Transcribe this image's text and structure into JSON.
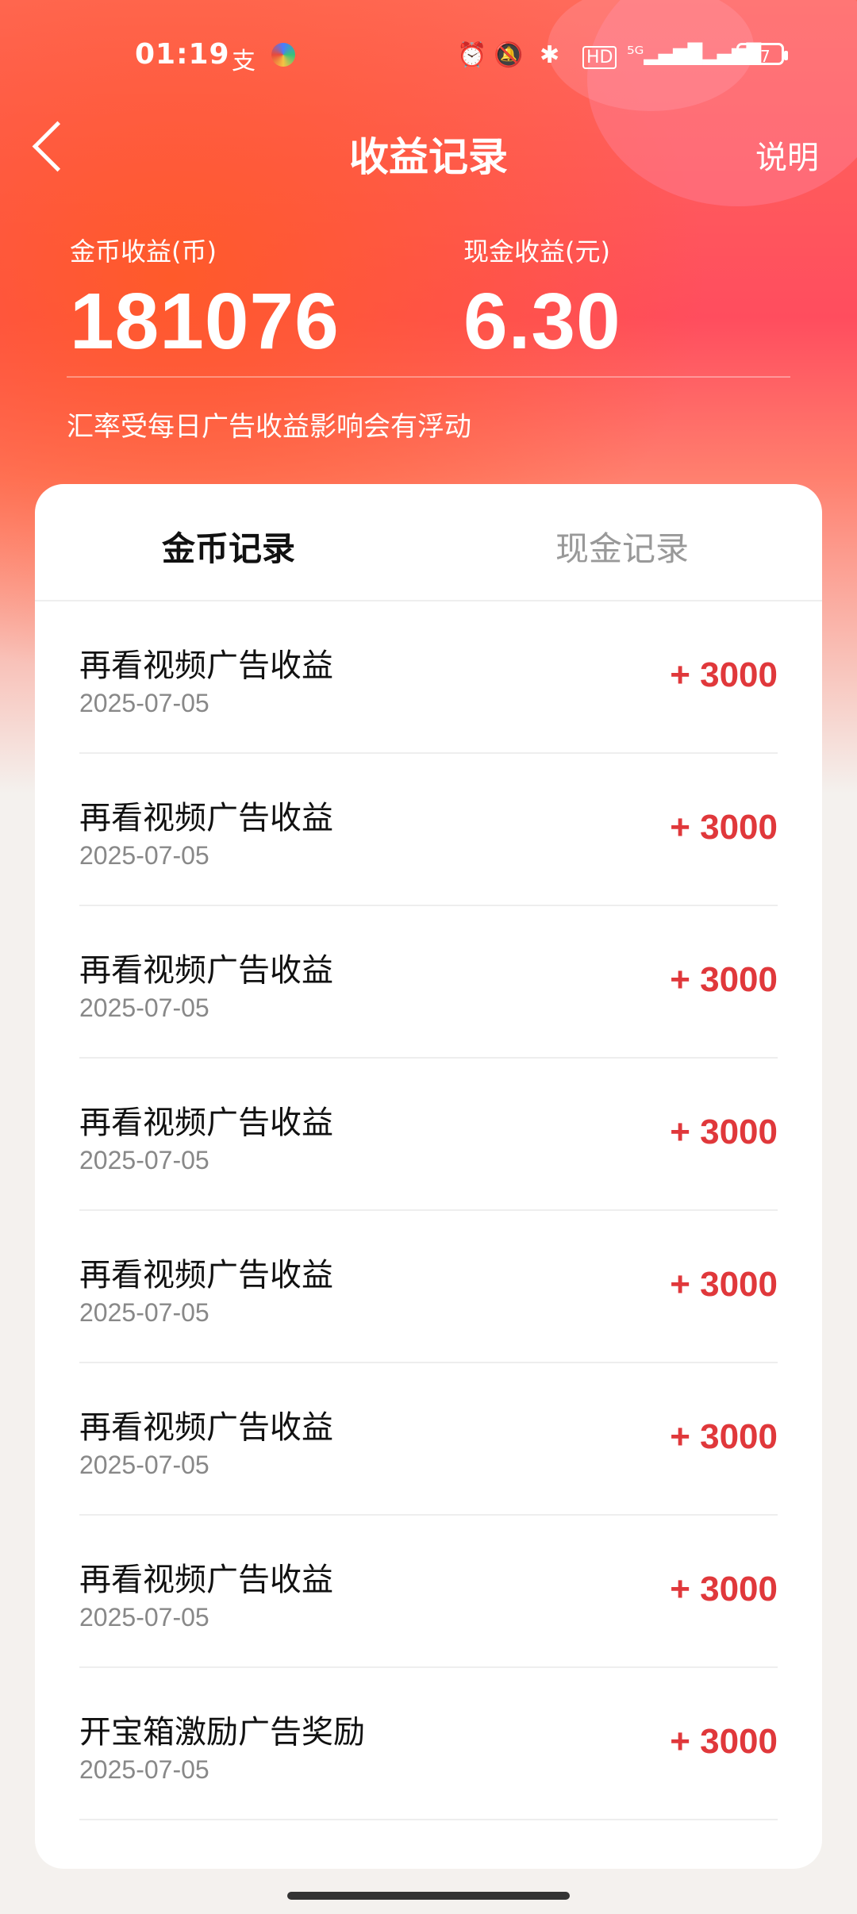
{
  "status_bar": {
    "time": "01:19",
    "battery": "37",
    "icons": [
      "alipay-icon",
      "colorful-app-icon",
      "alarm-icon",
      "mute-icon",
      "bluetooth-icon",
      "hd-icon",
      "5g-signal-icon",
      "4g-signal-icon",
      "battery-icon"
    ]
  },
  "header": {
    "title": "收益记录",
    "help_label": "说明"
  },
  "summary": {
    "coins_label": "金币收益(币)",
    "coins_value": "181076",
    "cash_label": "现金收益(元)",
    "cash_value": "6.30",
    "note": "汇率受每日广告收益影响会有浮动"
  },
  "tabs": [
    {
      "label": "金币记录",
      "active": true
    },
    {
      "label": "现金记录",
      "active": false
    }
  ],
  "records": [
    {
      "title": "再看视频广告收益",
      "date": "2025-07-05",
      "amount": "+ 3000"
    },
    {
      "title": "再看视频广告收益",
      "date": "2025-07-05",
      "amount": "+ 3000"
    },
    {
      "title": "再看视频广告收益",
      "date": "2025-07-05",
      "amount": "+ 3000"
    },
    {
      "title": "再看视频广告收益",
      "date": "2025-07-05",
      "amount": "+ 3000"
    },
    {
      "title": "再看视频广告收益",
      "date": "2025-07-05",
      "amount": "+ 3000"
    },
    {
      "title": "再看视频广告收益",
      "date": "2025-07-05",
      "amount": "+ 3000"
    },
    {
      "title": "再看视频广告收益",
      "date": "2025-07-05",
      "amount": "+ 3000"
    },
    {
      "title": "开宝箱激励广告奖励",
      "date": "2025-07-05",
      "amount": "+ 3000"
    }
  ],
  "colors": {
    "accent": "#e0383b",
    "header_gradient_top": "#ff6a5a",
    "header_gradient_mid": "#ff4d5e"
  }
}
